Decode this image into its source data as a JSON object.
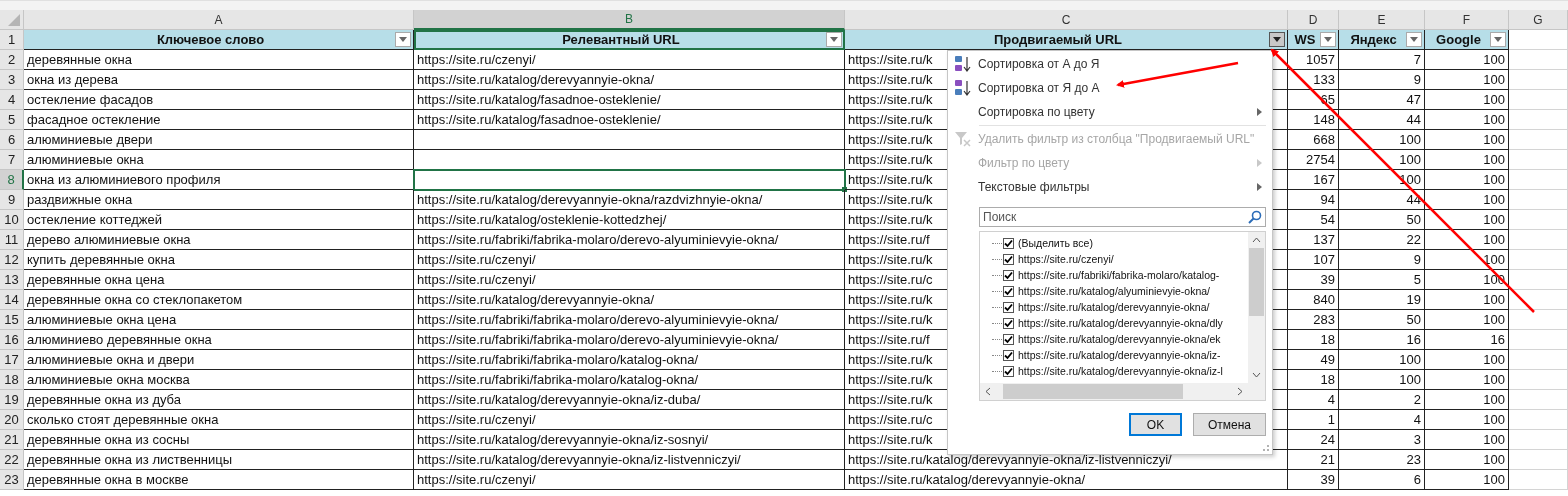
{
  "columns": [
    {
      "letter": "A",
      "heading": "Ключевое слово",
      "selected": false,
      "filter_open": false
    },
    {
      "letter": "B",
      "heading": "Релевантный URL",
      "selected": true,
      "filter_open": false
    },
    {
      "letter": "C",
      "heading": "Продвигаемый URL",
      "selected": false,
      "filter_open": true
    },
    {
      "letter": "D",
      "heading": "WS",
      "selected": false,
      "filter_open": false
    },
    {
      "letter": "E",
      "heading": "Яндекс",
      "selected": false,
      "filter_open": false
    },
    {
      "letter": "F",
      "heading": "Google",
      "selected": false,
      "filter_open": false
    },
    {
      "letter": "G",
      "selected": false
    }
  ],
  "header_row": "1",
  "rows": [
    {
      "number": "2",
      "selected": false,
      "cells": [
        "деревянные окна",
        "https://site.ru/czenyi/",
        "https://site.ru/k",
        "1057",
        "7",
        "100"
      ]
    },
    {
      "number": "3",
      "selected": false,
      "cells": [
        "окна из дерева",
        "https://site.ru/katalog/derevyannyie-okna/",
        "https://site.ru/k",
        "133",
        "9",
        "100"
      ]
    },
    {
      "number": "4",
      "selected": false,
      "cells": [
        "остекление фасадов",
        "https://site.ru/katalog/fasadnoe-osteklenie/",
        "https://site.ru/k",
        "65",
        "47",
        "100"
      ]
    },
    {
      "number": "5",
      "selected": false,
      "cells": [
        "фасадное остекление",
        "https://site.ru/katalog/fasadnoe-osteklenie/",
        "https://site.ru/k",
        "148",
        "44",
        "100"
      ]
    },
    {
      "number": "6",
      "selected": false,
      "cells": [
        "алюминиевые двери",
        null,
        "https://site.ru/k",
        "668",
        "100",
        "100"
      ]
    },
    {
      "number": "7",
      "selected": false,
      "cells": [
        "алюминиевые окна",
        null,
        "https://site.ru/k",
        "2754",
        "100",
        "100"
      ]
    },
    {
      "number": "8",
      "selected": true,
      "cells": [
        "окна из алюминиевого профиля",
        null,
        "https://site.ru/k",
        "167",
        "100",
        "100"
      ]
    },
    {
      "number": "9",
      "selected": false,
      "cells": [
        "раздвижные окна",
        "https://site.ru/katalog/derevyannyie-okna/razdvizhnyie-okna/",
        "https://site.ru/k",
        "94",
        "44",
        "100"
      ]
    },
    {
      "number": "10",
      "selected": false,
      "cells": [
        "остекление коттеджей",
        "https://site.ru/katalog/osteklenie-kottedzhej/",
        "https://site.ru/k",
        "54",
        "50",
        "100"
      ]
    },
    {
      "number": "11",
      "selected": false,
      "cells": [
        "дерево алюминиевые окна",
        "https://site.ru/fabriki/fabrika-molaro/derevo-alyuminievyie-okna/",
        "https://site.ru/f",
        "137",
        "22",
        "100"
      ]
    },
    {
      "number": "12",
      "selected": false,
      "cells": [
        "купить деревянные окна",
        "https://site.ru/czenyi/",
        "https://site.ru/k",
        "107",
        "9",
        "100"
      ]
    },
    {
      "number": "13",
      "selected": false,
      "cells": [
        "деревянные окна цена",
        "https://site.ru/czenyi/",
        "https://site.ru/c",
        "39",
        "5",
        "100"
      ]
    },
    {
      "number": "14",
      "selected": false,
      "cells": [
        "деревянные окна со стеклопакетом",
        "https://site.ru/katalog/derevyannyie-okna/",
        "https://site.ru/k",
        "840",
        "19",
        "100"
      ]
    },
    {
      "number": "15",
      "selected": false,
      "cells": [
        "алюминиевые окна цена",
        "https://site.ru/fabriki/fabrika-molaro/derevo-alyuminievyie-okna/",
        "https://site.ru/k",
        "283",
        "50",
        "100"
      ]
    },
    {
      "number": "16",
      "selected": false,
      "cells": [
        "алюминиево деревянные окна",
        "https://site.ru/fabriki/fabrika-molaro/derevo-alyuminievyie-okna/",
        "https://site.ru/f",
        "18",
        "16",
        "16"
      ]
    },
    {
      "number": "17",
      "selected": false,
      "cells": [
        "алюминиевые окна и двери",
        "https://site.ru/fabriki/fabrika-molaro/katalog-okna/",
        "https://site.ru/k",
        "49",
        "100",
        "100"
      ]
    },
    {
      "number": "18",
      "selected": false,
      "cells": [
        "алюминиевые окна москва",
        "https://site.ru/fabriki/fabrika-molaro/katalog-okna/",
        "https://site.ru/k",
        "18",
        "100",
        "100"
      ]
    },
    {
      "number": "19",
      "selected": false,
      "cells": [
        "деревянные окна из дуба",
        "https://site.ru/katalog/derevyannyie-okna/iz-duba/",
        "https://site.ru/k",
        "4",
        "2",
        "100"
      ]
    },
    {
      "number": "20",
      "selected": false,
      "cells": [
        "сколько стоят деревянные окна",
        "https://site.ru/czenyi/",
        "https://site.ru/c",
        "1",
        "4",
        "100"
      ]
    },
    {
      "number": "21",
      "selected": false,
      "cells": [
        "деревянные окна из сосны",
        "https://site.ru/katalog/derevyannyie-okna/iz-sosnyi/",
        "https://site.ru/k",
        "24",
        "3",
        "100"
      ]
    },
    {
      "number": "22",
      "selected": false,
      "cells": [
        "деревянные окна из лиственницы",
        "https://site.ru/katalog/derevyannyie-okna/iz-listvenniczyi/",
        "https://site.ru/katalog/derevyannyie-okna/iz-listvenniczyi/",
        "21",
        "23",
        "100"
      ]
    },
    {
      "number": "23",
      "selected": false,
      "cells": [
        "деревянные окна в москве",
        "https://site.ru/czenyi/",
        "https://site.ru/katalog/derevyannyie-okna/",
        "39",
        "6",
        "100"
      ]
    }
  ],
  "filter_menu": {
    "items": [
      {
        "kind": "sort_asc",
        "label": "Сортировка от А до Я",
        "disabled": false,
        "submenu": false
      },
      {
        "kind": "sort_desc",
        "label": "Сортировка от Я до А",
        "disabled": false,
        "submenu": false
      },
      {
        "kind": "plain",
        "label": "Сортировка по цвету",
        "disabled": false,
        "submenu": true
      },
      {
        "kind": "clear_filter",
        "label": "Удалить фильтр из столбца \"Продвигаемый URL\"",
        "disabled": true,
        "submenu": false
      },
      {
        "kind": "plain",
        "label": "Фильтр по цвету",
        "disabled": true,
        "submenu": true
      },
      {
        "kind": "plain",
        "label": "Текстовые фильтры",
        "disabled": false,
        "submenu": true
      }
    ],
    "search": {
      "placeholder": "Поиск"
    },
    "values": [
      {
        "label": "(Выделить все)",
        "checked": true
      },
      {
        "label": "https://site.ru/czenyi/",
        "checked": true
      },
      {
        "label": "https://site.ru/fabriki/fabrika-molaro/katalog-",
        "checked": true
      },
      {
        "label": "https://site.ru/katalog/alyuminievyie-okna/",
        "checked": true
      },
      {
        "label": "https://site.ru/katalog/derevyannyie-okna/",
        "checked": true
      },
      {
        "label": "https://site.ru/katalog/derevyannyie-okna/dly",
        "checked": true
      },
      {
        "label": "https://site.ru/katalog/derevyannyie-okna/ek",
        "checked": true
      },
      {
        "label": "https://site.ru/katalog/derevyannyie-okna/iz-",
        "checked": true
      },
      {
        "label": "https://site.ru/katalog/derevyannyie-okna/iz-l",
        "checked": true
      }
    ],
    "buttons": [
      {
        "label": "OK",
        "default": true
      },
      {
        "label": "Отмена",
        "default": false
      }
    ]
  }
}
